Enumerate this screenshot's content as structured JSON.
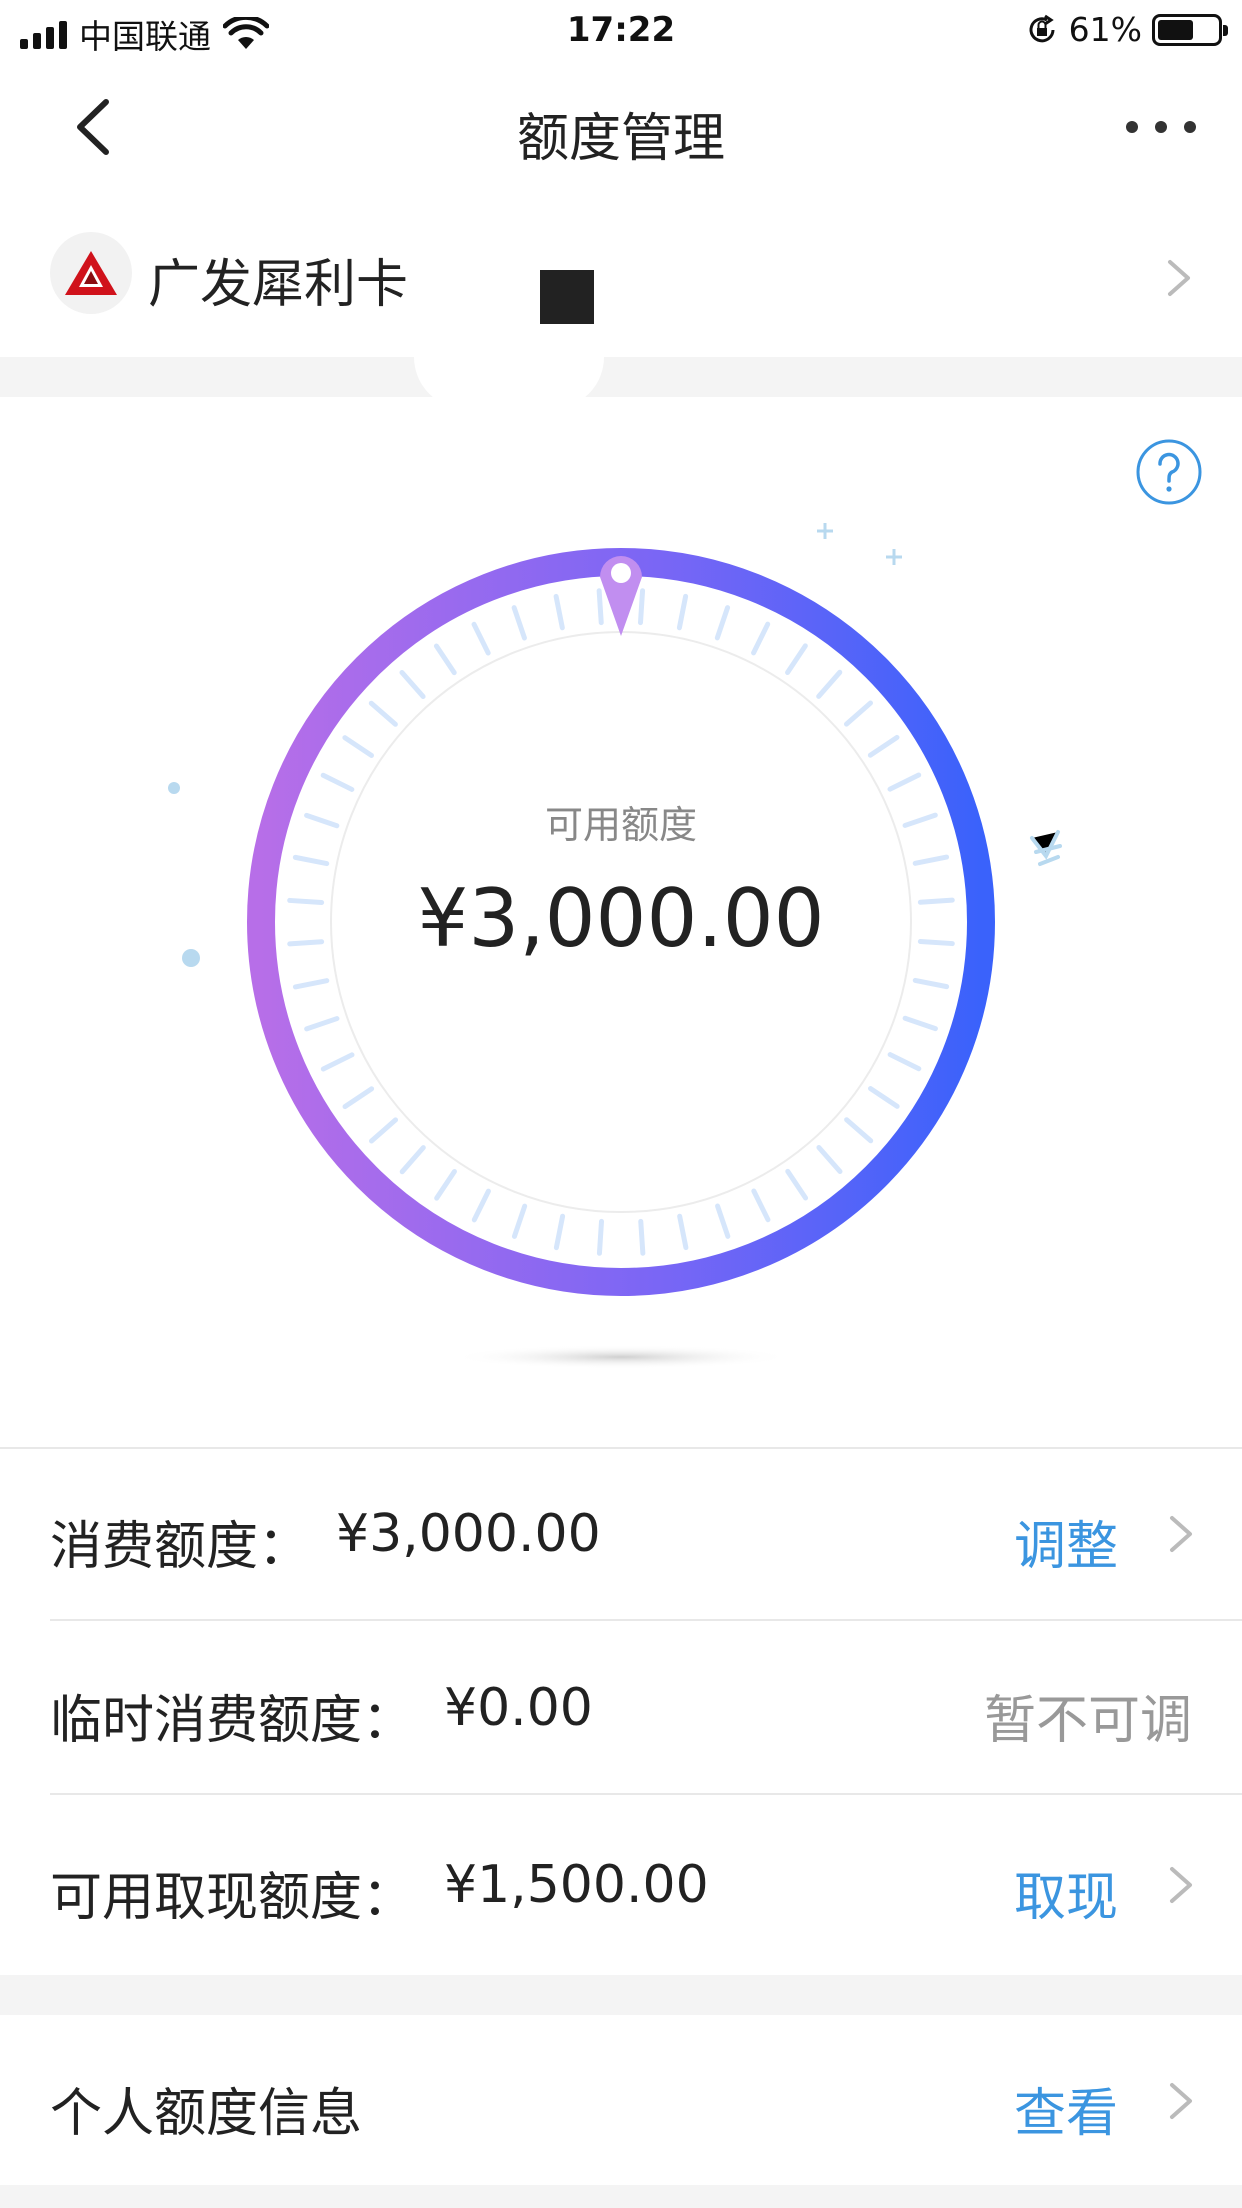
{
  "status_bar": {
    "carrier": "中国联通",
    "time": "17:22",
    "battery_percent": "61%",
    "battery_level": 0.61
  },
  "nav": {
    "title": "额度管理"
  },
  "card": {
    "name": "广发犀利卡"
  },
  "ring": {
    "label": "可用额度",
    "amount": "¥3,000.00",
    "gradient_start": "#b76ee8",
    "gradient_end": "#3a62fb"
  },
  "rows": [
    {
      "label": "消费额度：",
      "value": "¥3,000.00",
      "action": "调整",
      "enabled": true
    },
    {
      "label": "临时消费额度：",
      "value": "¥0.00",
      "action": "暂不可调",
      "enabled": false
    },
    {
      "label": "可用取现额度：",
      "value": "¥1,500.00",
      "action": "取现",
      "enabled": true
    }
  ],
  "personal": {
    "label": "个人额度信息",
    "action": "查看"
  },
  "colors": {
    "accent": "#3b95e0",
    "disabled": "#999999",
    "bank_red": "#d0121b"
  }
}
